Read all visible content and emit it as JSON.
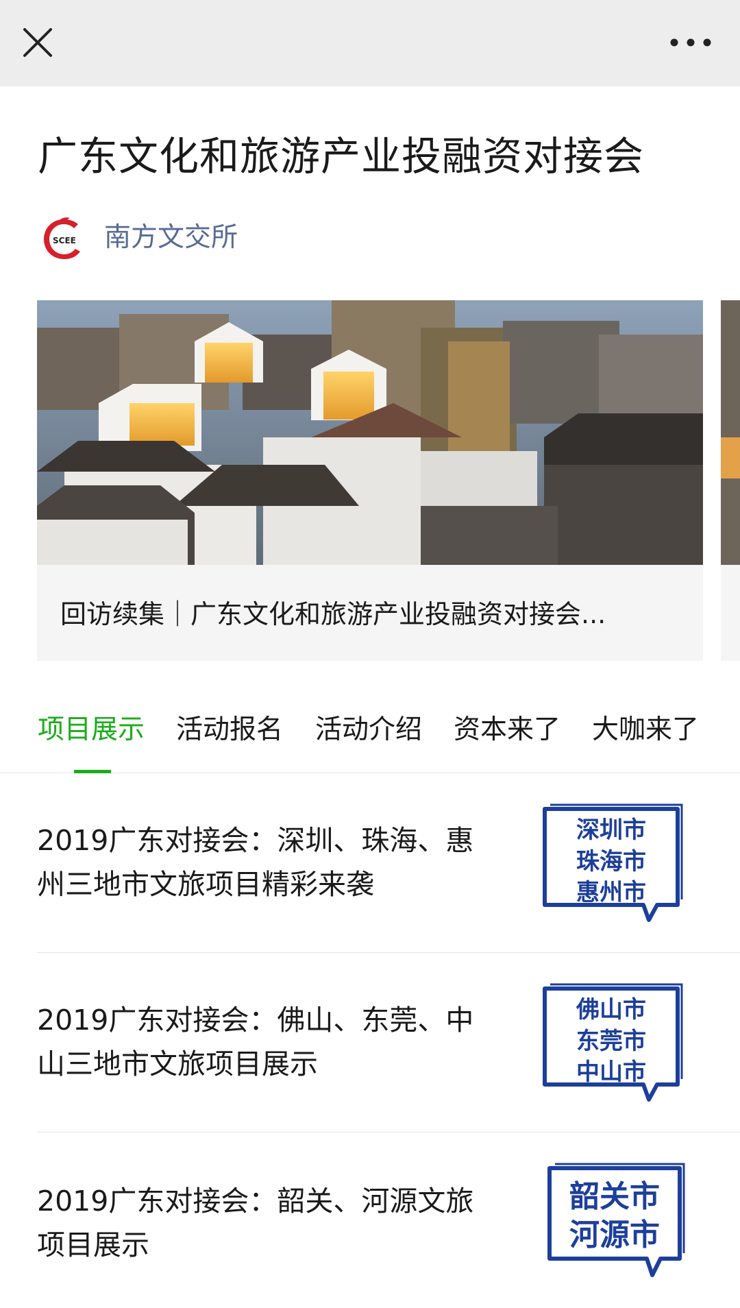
{
  "nav": {
    "close_icon": "close-icon",
    "more_icon": "more-dots-icon"
  },
  "article": {
    "title": "广东文化和旅游产业投融资对接会",
    "author": "南方文交所",
    "author_logo_text": "SCEE"
  },
  "carousel": {
    "caption": "回访续集｜广东文化和旅游产业投融资对接会..."
  },
  "tabs": [
    {
      "label": "项目展示",
      "active": true
    },
    {
      "label": "活动报名",
      "active": false
    },
    {
      "label": "活动介绍",
      "active": false
    },
    {
      "label": "资本来了",
      "active": false
    },
    {
      "label": "大咖来了",
      "active": false
    }
  ],
  "items": [
    {
      "title": "2019广东对接会：深圳、珠海、惠州三地市文旅项目精彩来袭",
      "thumb_lines": [
        "深圳市",
        "珠海市",
        "惠州市"
      ]
    },
    {
      "title": "2019广东对接会：佛山、东莞、中山三地市文旅项目展示",
      "thumb_lines": [
        "佛山市",
        "东莞市",
        "中山市"
      ]
    },
    {
      "title": "2019广东对接会：韶关、河源文旅项目展示",
      "thumb_lines": [
        "韶关市",
        "河源市"
      ]
    }
  ],
  "colors": {
    "accent": "#1aad19",
    "link": "#576b95",
    "thumb_blue": "#1d3f9c",
    "logo_red": "#d6202a"
  }
}
